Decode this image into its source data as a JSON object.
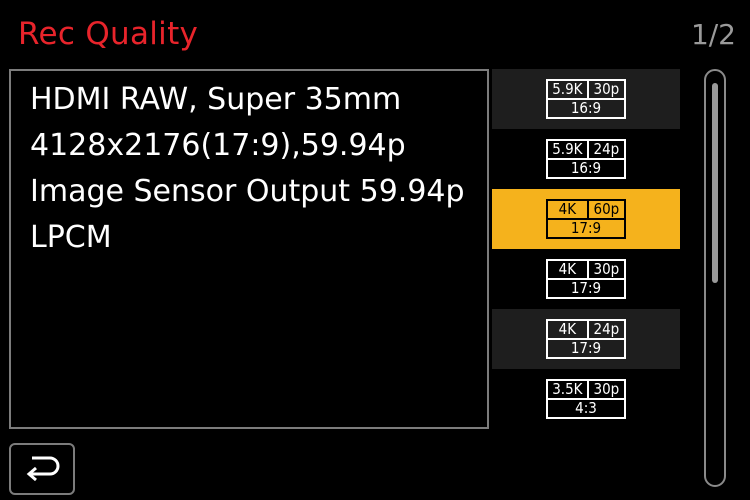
{
  "header": {
    "title": "Rec Quality",
    "page_indicator": "1/2"
  },
  "info": {
    "lines": [
      "HDMI RAW, Super 35mm",
      "4128x2176(17:9),59.94p",
      "Image Sensor Output 59.94p",
      "LPCM"
    ]
  },
  "options": [
    {
      "resolution": "5.9K",
      "framerate": "30p",
      "aspect": "16:9"
    },
    {
      "resolution": "5.9K",
      "framerate": "24p",
      "aspect": "16:9"
    },
    {
      "resolution": "4K",
      "framerate": "60p",
      "aspect": "17:9"
    },
    {
      "resolution": "4K",
      "framerate": "30p",
      "aspect": "17:9"
    },
    {
      "resolution": "4K",
      "framerate": "24p",
      "aspect": "17:9"
    },
    {
      "resolution": "3.5K",
      "framerate": "30p",
      "aspect": "4:3"
    }
  ],
  "selected_index": 2,
  "colors": {
    "title": "#e8242b",
    "selection": "#f5b21c",
    "background": "#000000"
  },
  "icons": {
    "back": "return-arrow-icon"
  }
}
